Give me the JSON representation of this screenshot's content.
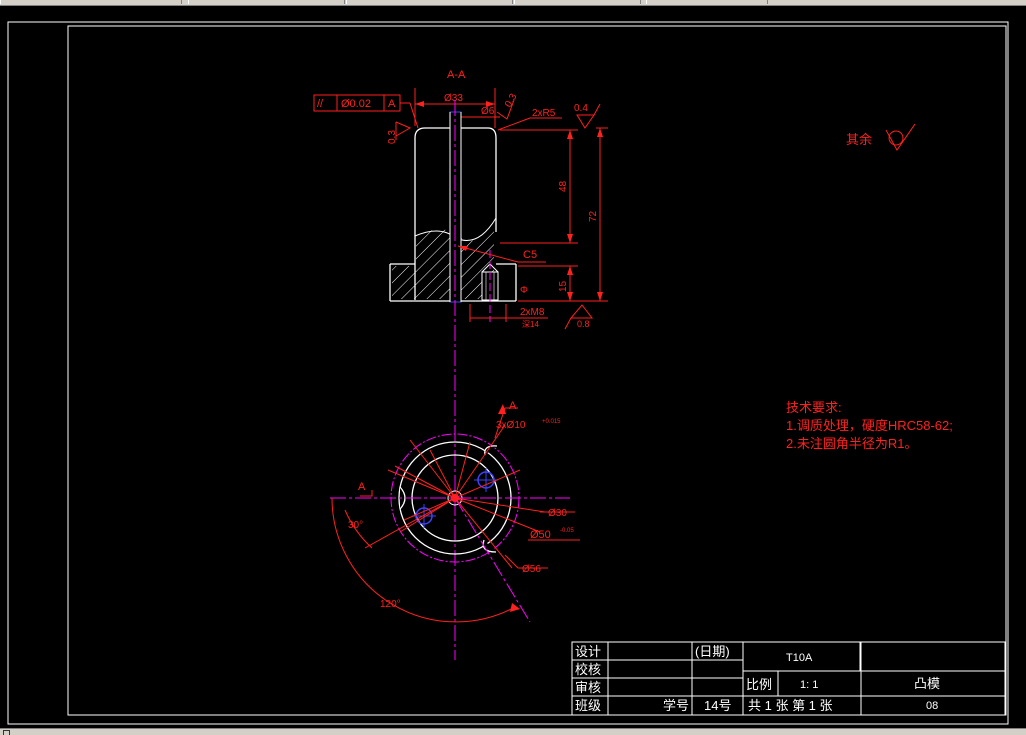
{
  "window": {
    "type": "cad-drawing-viewport"
  },
  "drawing": {
    "section_title": "A-A",
    "tolerance_frame": {
      "symbol": "//",
      "value": "Ø0.02",
      "datum": "A"
    },
    "roughness_left": "0.3",
    "roughness_top_mid": "0.3",
    "roughness_top_right": "0.4",
    "roughness_bottom": "0.8",
    "dim_d33": "Ø33",
    "dim_d6": "Ø6",
    "dim_2xR5": "2xR5",
    "dim_48": "48",
    "dim_72": "72",
    "dim_15": "15",
    "dim_c5": "C5",
    "dim_2xm8": "2xM8",
    "dim_depth": "深14",
    "other_label": "其余",
    "plan_A_label": "A",
    "plan_left_A": "A",
    "dim_holes": "3xØ10",
    "dim_holes_tol": "+0.015",
    "dim_d30": "Ø30",
    "dim_d50": "Ø50",
    "dim_d50_tol": "-0.05",
    "dim_d56": "Ø56",
    "angle_30": "30°",
    "angle_120": "120°",
    "tech_title": "技术要求:",
    "tech_line1": "1.调质处理，硬度HRC58-62;",
    "tech_line2": "2.未注圆角半径为R1。"
  },
  "title_block": {
    "design": "设计",
    "date": "(日期)",
    "material": "T10A",
    "check": "校核",
    "review": "审核",
    "scale_label": "比例",
    "scale_value": "1: 1",
    "part_name": "凸模",
    "class_label": "班级",
    "student_no_label": "学号",
    "student_no": "14号",
    "sheets": "共 1 张 第 1 张",
    "drawing_no": "08"
  },
  "colors": {
    "background": "#000000",
    "frame": "#ffffff",
    "dimension": "#ff0000",
    "centerline": "#ff00ff",
    "hatch": "#ffffff",
    "hole": "#4040ff"
  }
}
